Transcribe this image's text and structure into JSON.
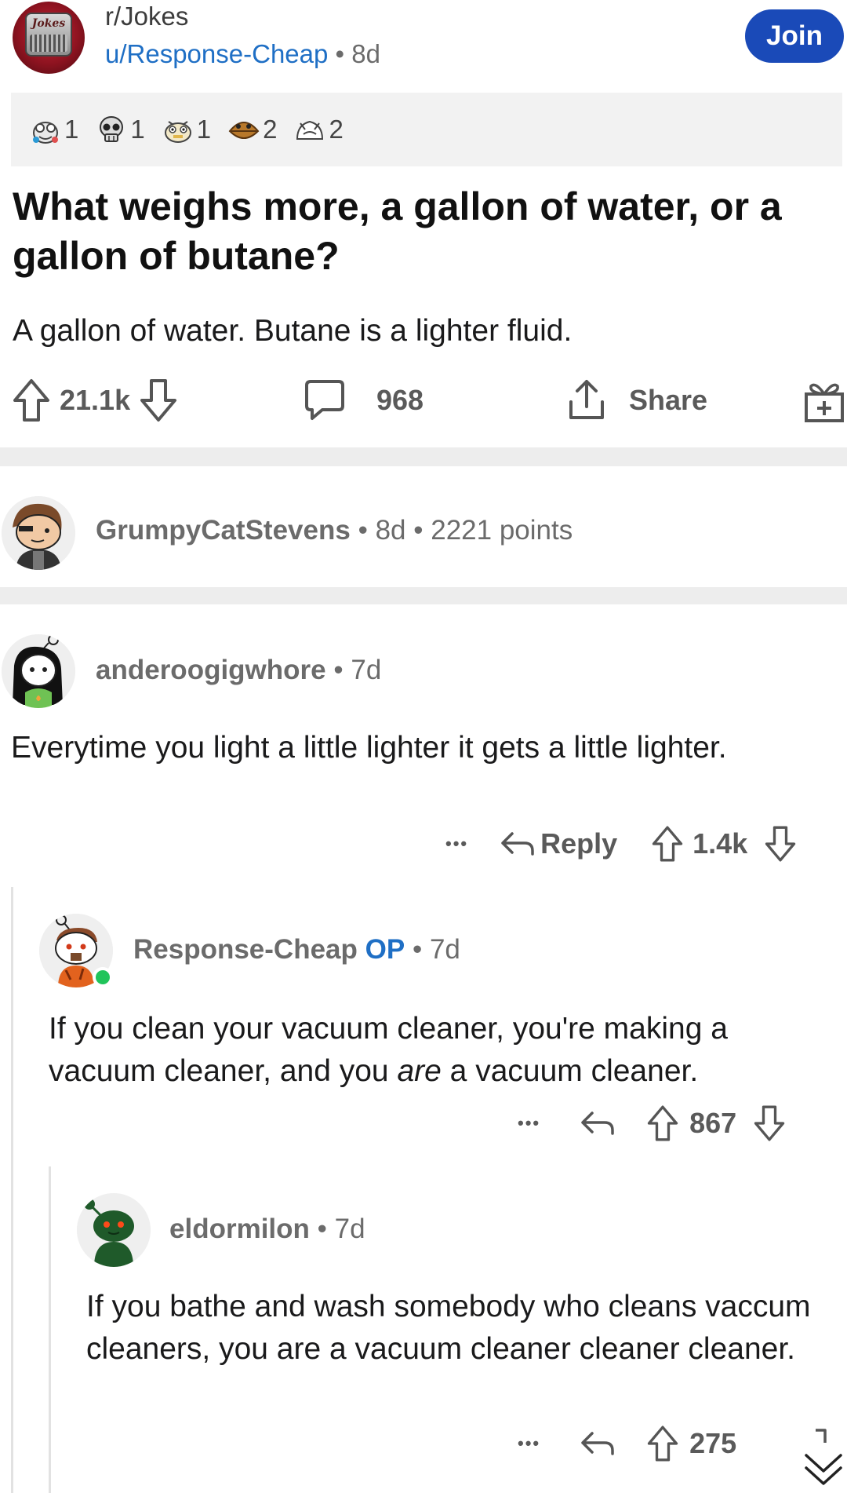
{
  "header": {
    "subreddit": "r/Jokes",
    "avatar_text": "Jokes",
    "author": "u/Response-Cheap",
    "separator": "•",
    "age": "8d",
    "join_label": "Join"
  },
  "awards": [
    {
      "icon": "award-icon-1",
      "count": "1"
    },
    {
      "icon": "skull-award-icon",
      "count": "1"
    },
    {
      "icon": "award-icon-3",
      "count": "1"
    },
    {
      "icon": "award-icon-4",
      "count": "2"
    },
    {
      "icon": "award-icon-5",
      "count": "2"
    }
  ],
  "post": {
    "title": "What weighs more, a gallon of water, or a gallon of butane?",
    "body": "A gallon of water. Butane is a lighter fluid.",
    "upvotes": "21.1k",
    "comments": "968",
    "share_label": "Share"
  },
  "removed_comment": {
    "username": "GrumpyCatStevens",
    "age": "8d",
    "points": "2221 points"
  },
  "comments": [
    {
      "username": "anderoogigwhore",
      "age": "7d",
      "body": "Everytime you light a little lighter it gets a little lighter.",
      "reply_label": "Reply",
      "score": "1.4k",
      "more_label": "•••"
    },
    {
      "username": "Response-Cheap",
      "op_label": "OP",
      "age": "7d",
      "body_before": "If you clean your vacuum cleaner, you're making a vacuum cleaner, and you ",
      "body_italic": "are",
      "body_after": " a vacuum cleaner.",
      "score": "867",
      "more_label": "•••"
    },
    {
      "username": "eldormilon",
      "age": "7d",
      "body": "If you bathe and wash somebody who cleans vaccum cleaners, you are a vacuum cleaner cleaner cleaner.",
      "score": "275",
      "more_label": "•••"
    }
  ],
  "colors": {
    "join": "#1a4ab8",
    "link": "#1f6fc5",
    "muted": "#6b6b6b",
    "separator": "#ededed"
  }
}
